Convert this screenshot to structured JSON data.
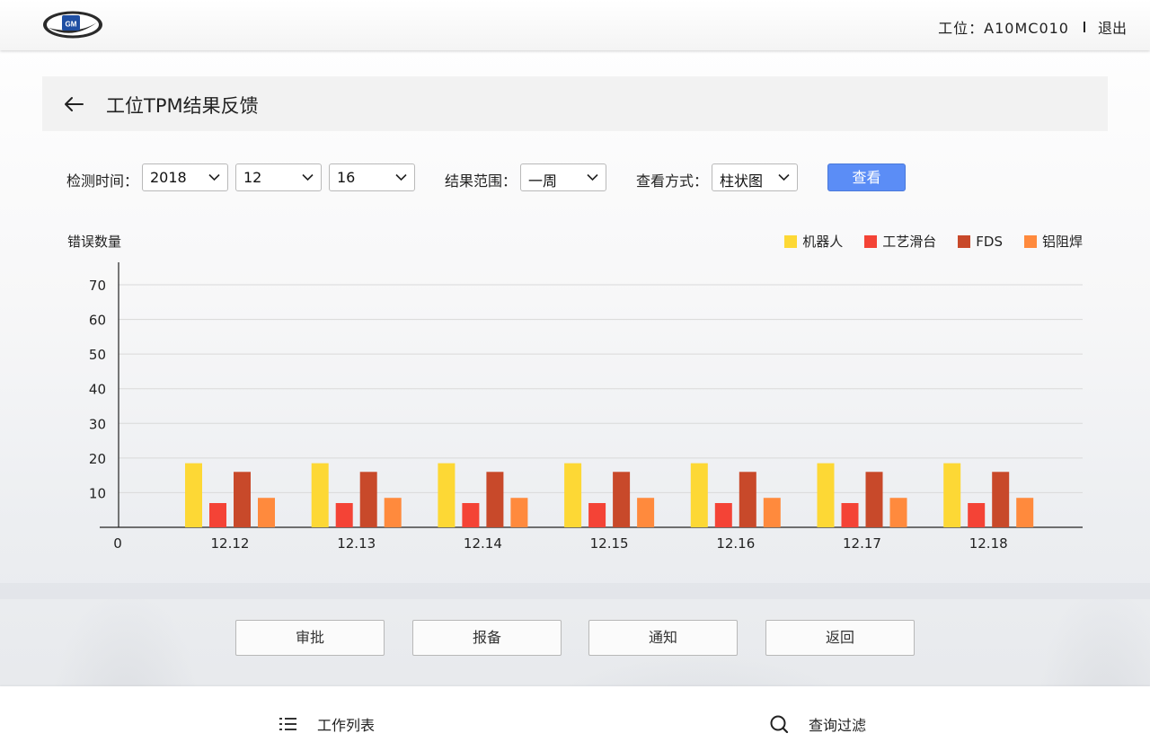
{
  "header": {
    "station_text": "工位：A10MC010",
    "logout_label": "退出",
    "logo_text": "GM"
  },
  "page": {
    "title": "工位TPM结果反馈"
  },
  "filters": {
    "time_label": "检测时间：",
    "year": "2018",
    "month": "12",
    "day": "16",
    "range_label": "结果范围：",
    "range_value": "一周",
    "view_label": "查看方式：",
    "view_value": "柱状图",
    "query_button": "查看"
  },
  "colors": {
    "accent_blue": "#5b8df6",
    "robot": "#fdd835",
    "process_slide": "#f44336",
    "fds": "#c8492a",
    "aluminum_weld": "#ff8a3d"
  },
  "icons": {
    "back": "arrow-left-icon",
    "chevron": "chevron-down-icon",
    "list": "list-icon",
    "search": "search-icon"
  },
  "chart_data": {
    "type": "bar",
    "ylabel": "错误数量",
    "xlabel": "",
    "origin_label": "0",
    "categories": [
      "12.12",
      "12.13",
      "12.14",
      "12.15",
      "12.16",
      "12.17",
      "12.18"
    ],
    "yticks": [
      10,
      20,
      30,
      40,
      50,
      60,
      70
    ],
    "ylim": [
      0,
      70
    ],
    "grid": true,
    "legend_position": "top-right",
    "series": [
      {
        "name": "机器人",
        "color": "#fdd835",
        "values": [
          18.5,
          18.5,
          18.5,
          18.5,
          18.5,
          18.5,
          18.5
        ]
      },
      {
        "name": "工艺滑台",
        "color": "#f44336",
        "values": [
          7,
          7,
          7,
          7,
          7,
          7,
          7
        ]
      },
      {
        "name": "FDS",
        "color": "#c8492a",
        "values": [
          16,
          16,
          16,
          16,
          16,
          16,
          16
        ]
      },
      {
        "name": "铝阻焊",
        "color": "#ff8a3d",
        "values": [
          8.5,
          8.5,
          8.5,
          8.5,
          8.5,
          8.5,
          8.5
        ]
      }
    ]
  },
  "actions": {
    "approve": "审批",
    "report": "报备",
    "notify": "通知",
    "back": "返回"
  },
  "footer": {
    "work_list": "工作列表",
    "query_filter": "查询过滤"
  }
}
